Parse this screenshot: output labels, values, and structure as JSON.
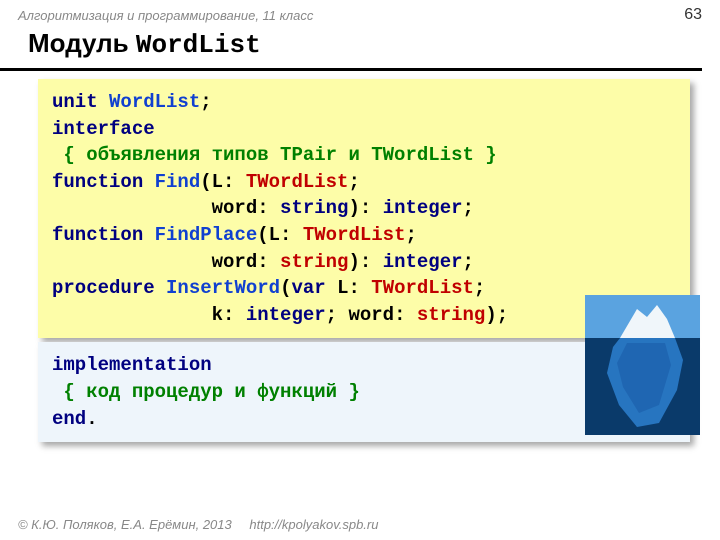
{
  "header": {
    "course": "Алгоритмизация и программирование, 11 класс",
    "page": "63"
  },
  "title": {
    "prefix": "Модуль ",
    "mono": "WordList"
  },
  "code_interface": [
    [
      {
        "cls": "kw",
        "t": "unit "
      },
      {
        "cls": "ident",
        "t": "WordList"
      },
      {
        "cls": "normal",
        "t": ";"
      }
    ],
    [
      {
        "cls": "kw",
        "t": "interface"
      }
    ],
    [
      {
        "cls": "comment",
        "t": " { объявления типов TPair и TWordList }"
      }
    ],
    [
      {
        "cls": "kw",
        "t": "function "
      },
      {
        "cls": "ident",
        "t": "Find"
      },
      {
        "cls": "normal",
        "t": "(L: "
      },
      {
        "cls": "type",
        "t": "TWordList"
      },
      {
        "cls": "normal",
        "t": ";"
      }
    ],
    [
      {
        "cls": "normal",
        "t": "              word: "
      },
      {
        "cls": "kw",
        "t": "string"
      },
      {
        "cls": "normal",
        "t": "): "
      },
      {
        "cls": "kw",
        "t": "integer"
      },
      {
        "cls": "normal",
        "t": ";"
      }
    ],
    [
      {
        "cls": "kw",
        "t": "function "
      },
      {
        "cls": "ident",
        "t": "FindPlace"
      },
      {
        "cls": "normal",
        "t": "(L: "
      },
      {
        "cls": "type",
        "t": "TWordList"
      },
      {
        "cls": "normal",
        "t": ";"
      }
    ],
    [
      {
        "cls": "normal",
        "t": "              word: "
      },
      {
        "cls": "type",
        "t": "string"
      },
      {
        "cls": "normal",
        "t": "): "
      },
      {
        "cls": "kw",
        "t": "integer"
      },
      {
        "cls": "normal",
        "t": ";"
      }
    ],
    [
      {
        "cls": "kw",
        "t": "procedure "
      },
      {
        "cls": "ident",
        "t": "InsertWord"
      },
      {
        "cls": "normal",
        "t": "("
      },
      {
        "cls": "kw",
        "t": "var"
      },
      {
        "cls": "normal",
        "t": " L: "
      },
      {
        "cls": "type",
        "t": "TWordList"
      },
      {
        "cls": "normal",
        "t": ";"
      }
    ],
    [
      {
        "cls": "normal",
        "t": "              k: "
      },
      {
        "cls": "kw",
        "t": "integer"
      },
      {
        "cls": "normal",
        "t": "; word: "
      },
      {
        "cls": "type",
        "t": "string"
      },
      {
        "cls": "normal",
        "t": ");"
      }
    ]
  ],
  "code_impl": [
    [
      {
        "cls": "kw",
        "t": "implementation"
      }
    ],
    [
      {
        "cls": "comment",
        "t": " { код процедур и функций }"
      }
    ],
    [
      {
        "cls": "kw",
        "t": "end"
      },
      {
        "cls": "normal",
        "t": "."
      }
    ]
  ],
  "footer": {
    "copyright": "© К.Ю. Поляков, Е.А. Ерёмин, 2013",
    "url": "http://kpolyakov.spb.ru"
  }
}
